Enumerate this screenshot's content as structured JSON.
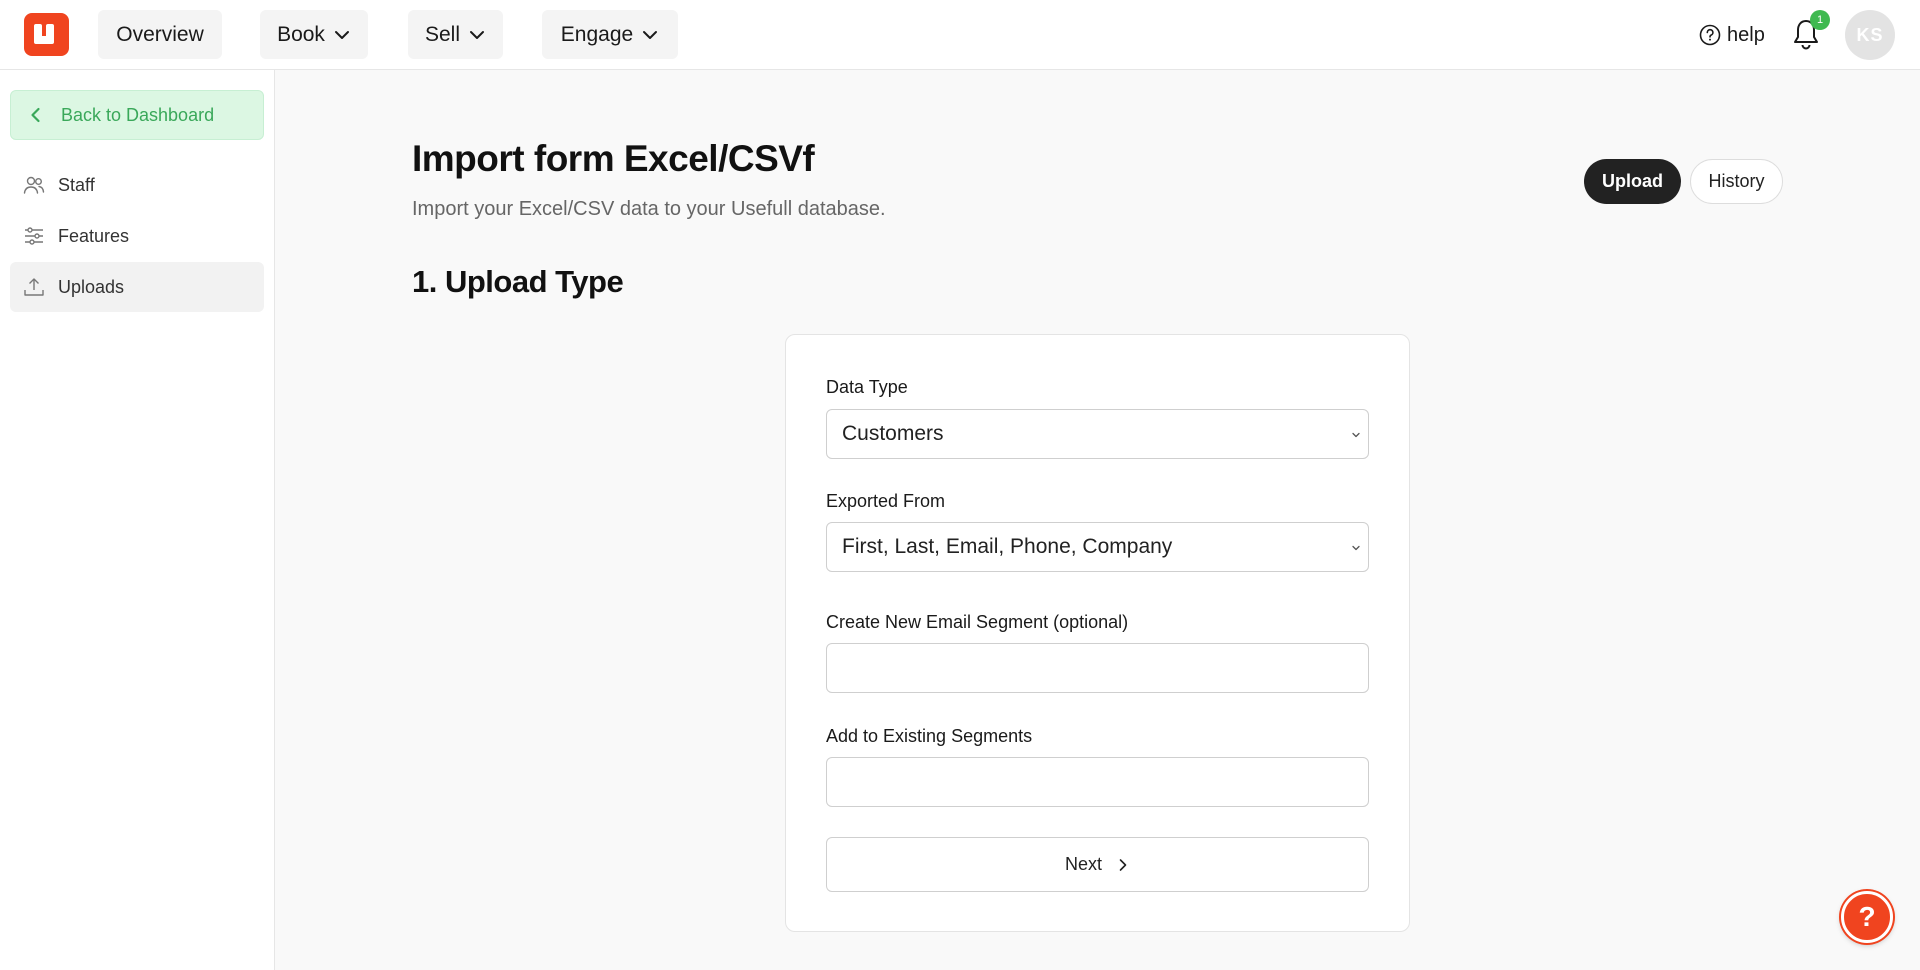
{
  "topnav": {
    "items": [
      {
        "label": "Overview",
        "has_dropdown": false
      },
      {
        "label": "Book",
        "has_dropdown": true
      },
      {
        "label": "Sell",
        "has_dropdown": true
      },
      {
        "label": "Engage",
        "has_dropdown": true
      }
    ],
    "help_label": "help",
    "notification_count": "1",
    "avatar_initials": "KS"
  },
  "sidebar": {
    "back_label": "Back to Dashboard",
    "items": [
      {
        "label": "Staff",
        "icon": "users-icon",
        "active": false
      },
      {
        "label": "Features",
        "icon": "sliders-icon",
        "active": false
      },
      {
        "label": "Uploads",
        "icon": "upload-icon",
        "active": true
      }
    ]
  },
  "main": {
    "title": "Import form Excel/CSVf",
    "subtitle": "Import your Excel/CSV data to your Usefull database.",
    "tabs": [
      {
        "label": "Upload",
        "active": true
      },
      {
        "label": "History",
        "active": false
      }
    ],
    "section_title": "1. Upload Type",
    "form": {
      "data_type_label": "Data Type",
      "data_type_value": "Customers",
      "exported_from_label": "Exported From",
      "exported_from_value": "First, Last, Email, Phone, Company",
      "new_segment_label": "Create New Email Segment (optional)",
      "new_segment_value": "",
      "existing_segments_label": "Add to Existing Segments",
      "existing_segments_value": "",
      "next_label": "Next"
    }
  },
  "fab_label": "?",
  "colors": {
    "brand": "#f0441f",
    "success": "#3fb950",
    "back_button_bg": "#dcf7e3",
    "dark_toggle": "#222222"
  }
}
